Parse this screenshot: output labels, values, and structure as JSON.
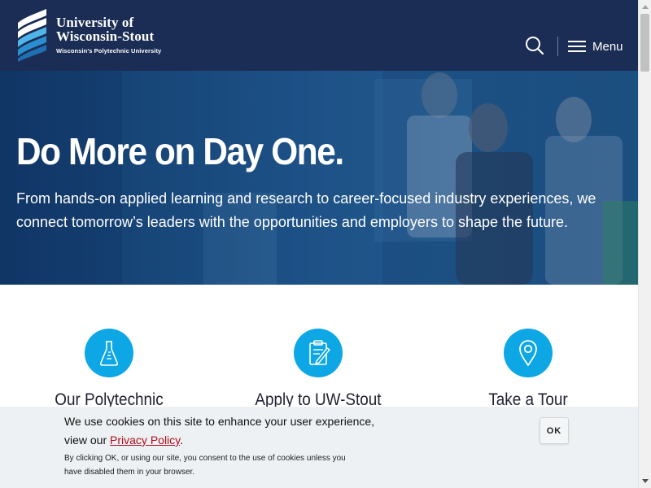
{
  "header": {
    "brand_line1": "University of",
    "brand_line2": "Wisconsin-Stout",
    "brand_tagline": "Wisconsin's Polytechnic University",
    "menu_label": "Menu",
    "search_icon": "search-icon",
    "menu_icon": "hamburger-icon"
  },
  "hero": {
    "title": "Do More on Day One.",
    "text": "From hands-on applied learning and research to career-focused industry experiences, we connect tomorrow’s leaders with the opportunities and employers to shape the future."
  },
  "features": [
    {
      "label": "Our Polytechnic",
      "icon": "flask-icon"
    },
    {
      "label": "Apply to UW-Stout",
      "icon": "clipboard-icon"
    },
    {
      "label": "Take a Tour",
      "icon": "map-pin-icon"
    }
  ],
  "cookie": {
    "text_before": "We use cookies on this site to enhance your user experience, view our ",
    "link_text": "Privacy Policy",
    "text_after": ".",
    "sub_text": "By clicking OK, or using our site, you consent to the use of cookies unless you have disabled them in your browser.",
    "ok_label": "OK"
  },
  "colors": {
    "header_bg": "#1b2d54",
    "accent": "#0ea7e5",
    "link": "#b00a1a"
  }
}
